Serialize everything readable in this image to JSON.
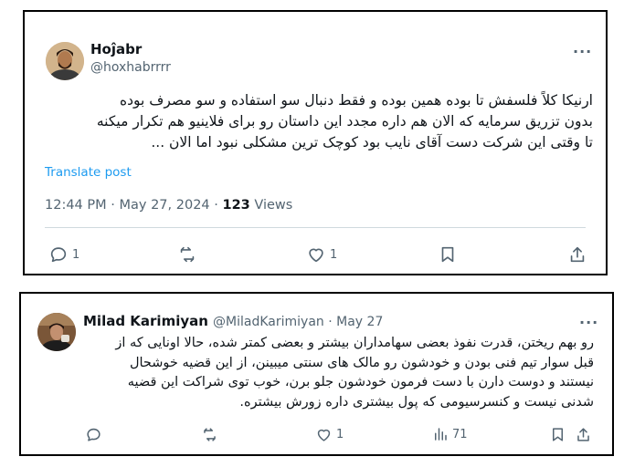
{
  "tweet1": {
    "author_name": "Hoĵabr",
    "author_handle": "@hoxhabrrrr",
    "more": "···",
    "text_lines": [
      "ارنیکا کلاً فلسفش تا بوده همین بوده و فقط دنبال سو استفاده و سو مصرف بوده",
      "بدون تزریق سرمایه که الان هم داره مجدد این داستان رو برای فلاینیو هم تکرار میکنه",
      "تا وقتی این شرکت دست آقای نایب بود کوچک ترین مشکلی نبود اما الان ..."
    ],
    "translate": "Translate post",
    "time": "12:44 PM",
    "sep1": " · ",
    "date": "May 27, 2024",
    "sep2": " · ",
    "views": "123",
    "views_label": " Views",
    "actions": {
      "reply_count": "1",
      "retweet_count": "",
      "like_count": "1"
    }
  },
  "tweet2": {
    "author_name": "Milad Karimiyan",
    "author_handle": "@MiladKarimiyan",
    "sep": " · ",
    "date": "May 27",
    "more": "···",
    "text_lines": [
      "رو بهم ریختن، قدرت نفوذ بعضی سهامداران بیشتر و بعضی کمتر شده، حالا اونایی که از",
      "قبل سوار تیم فنی بودن و خودشون رو مالک های سنتی میبینن، از این قضیه خوشحال",
      "نیستند و دوست دارن با دست فرمون خودشون جلو برن، خوب توی شراکت این قضیه",
      "شدنی نیست و کنسرسیومی که پول بیشتری داره زورش بیشتره."
    ],
    "actions": {
      "reply_count": "",
      "retweet_count": "",
      "like_count": "1",
      "views_count": "71"
    }
  },
  "colors": {
    "text": "#0f1419",
    "muted": "#536471",
    "link": "#1d9bf0",
    "divider": "#cfd9de"
  }
}
